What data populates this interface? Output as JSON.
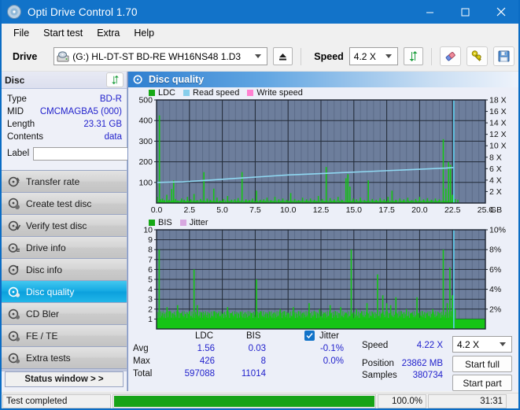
{
  "window": {
    "title": "Opti Drive Control 1.70",
    "icon": "disc-icon",
    "minimize": "minimize-icon",
    "maximize": "maximize-icon",
    "close": "close-icon"
  },
  "menu": [
    {
      "label": "File"
    },
    {
      "label": "Start test"
    },
    {
      "label": "Extra"
    },
    {
      "label": "Help"
    }
  ],
  "toolbar": {
    "drive_label": "Drive",
    "drive_value": "(G:)  HL-DT-ST BD-RE  WH16NS48 1.D3",
    "eject_icon": "eject-icon",
    "speed_label": "Speed",
    "speed_value": "4.2 X",
    "refresh_icon": "refresh-icon",
    "eraser_icon": "eraser-icon",
    "settings_icon": "keys-icon",
    "save_icon": "save-icon"
  },
  "disc": {
    "header": "Disc",
    "refresh_icon": "refresh-icon",
    "rows": [
      {
        "key": "Type",
        "value": "BD-R"
      },
      {
        "key": "MID",
        "value": "CMCMAGBA5 (000)"
      },
      {
        "key": "Length",
        "value": "23.31 GB"
      },
      {
        "key": "Contents",
        "value": "data"
      }
    ],
    "label_key": "Label",
    "label_value": "",
    "label_placeholder": "",
    "label_button_icon": "disc-icon"
  },
  "sidebar": {
    "items": [
      {
        "label": "Transfer rate",
        "icon": "disc-speed-icon",
        "active": false
      },
      {
        "label": "Create test disc",
        "icon": "disc-write-icon",
        "active": false
      },
      {
        "label": "Verify test disc",
        "icon": "disc-verify-icon",
        "active": false
      },
      {
        "label": "Drive info",
        "icon": "drive-info-icon",
        "active": false
      },
      {
        "label": "Disc info",
        "icon": "disc-info-icon",
        "active": false
      },
      {
        "label": "Disc quality",
        "icon": "disc-quality-icon",
        "active": true
      },
      {
        "label": "CD Bler",
        "icon": "disc-bler-icon",
        "active": false
      },
      {
        "label": "FE / TE",
        "icon": "disc-fete-icon",
        "active": false
      },
      {
        "label": "Extra tests",
        "icon": "disc-extra-icon",
        "active": false
      }
    ],
    "status_window_button": "Status window > >"
  },
  "panel": {
    "title": "Disc quality",
    "icon": "disc-quality-icon"
  },
  "chart_data": [
    {
      "id": "ldc-chart",
      "type": "line",
      "title": "",
      "xlabel": "GB",
      "ylabel": "",
      "xlim": [
        0.0,
        25.0
      ],
      "xticks": [
        "0.0",
        "2.5",
        "5.0",
        "7.5",
        "10.0",
        "12.5",
        "15.0",
        "17.5",
        "20.0",
        "22.5",
        "25.0"
      ],
      "x_unit": "GB",
      "ylim": [
        0,
        500
      ],
      "yticks": [
        "100",
        "200",
        "300",
        "400",
        "500"
      ],
      "y2lim": [
        0,
        18
      ],
      "y2ticks": [
        "2 X",
        "4 X",
        "6 X",
        "8 X",
        "10 X",
        "12 X",
        "14 X",
        "16 X",
        "18 X"
      ],
      "grid": true,
      "legend_position": "top-left",
      "series": [
        {
          "name": "LDC",
          "color": "#16c416",
          "type": "impulse"
        },
        {
          "name": "Read speed",
          "color": "#87ceeb",
          "type": "line"
        },
        {
          "name": "Write speed",
          "color": "#ff80d0",
          "type": "line"
        }
      ],
      "ldc_spikes": [
        [
          0.05,
          30
        ],
        [
          0.22,
          425
        ],
        [
          0.3,
          18
        ],
        [
          0.45,
          22
        ],
        [
          0.6,
          14
        ],
        [
          0.78,
          40
        ],
        [
          0.95,
          16
        ],
        [
          1.15,
          68
        ],
        [
          1.3,
          110
        ],
        [
          1.45,
          20
        ],
        [
          1.6,
          12
        ],
        [
          1.9,
          22
        ],
        [
          2.1,
          16
        ],
        [
          2.35,
          30
        ],
        [
          2.6,
          18
        ],
        [
          2.85,
          44
        ],
        [
          3.1,
          14
        ],
        [
          3.35,
          20
        ],
        [
          3.6,
          150
        ],
        [
          3.85,
          22
        ],
        [
          4.1,
          16
        ],
        [
          4.35,
          70
        ],
        [
          4.6,
          26
        ],
        [
          4.85,
          12
        ],
        [
          5.1,
          20
        ],
        [
          5.4,
          34
        ],
        [
          5.7,
          16
        ],
        [
          5.95,
          18
        ],
        [
          6.2,
          24
        ],
        [
          6.5,
          150
        ],
        [
          6.8,
          18
        ],
        [
          7.05,
          14
        ],
        [
          7.3,
          22
        ],
        [
          7.6,
          60
        ],
        [
          7.9,
          16
        ],
        [
          8.15,
          18
        ],
        [
          8.4,
          26
        ],
        [
          8.7,
          14
        ],
        [
          9.0,
          30
        ],
        [
          9.3,
          18
        ],
        [
          9.6,
          22
        ],
        [
          9.9,
          16
        ],
        [
          10.2,
          48
        ],
        [
          10.5,
          20
        ],
        [
          10.8,
          14
        ],
        [
          11.1,
          26
        ],
        [
          11.4,
          18
        ],
        [
          11.7,
          22
        ],
        [
          12.0,
          16
        ],
        [
          12.3,
          34
        ],
        [
          12.6,
          20
        ],
        [
          12.9,
          175
        ],
        [
          13.2,
          24
        ],
        [
          13.5,
          18
        ],
        [
          13.8,
          30
        ],
        [
          14.1,
          16
        ],
        [
          14.4,
          120
        ],
        [
          14.55,
          140
        ],
        [
          14.7,
          80
        ],
        [
          14.95,
          22
        ],
        [
          15.2,
          18
        ],
        [
          15.5,
          26
        ],
        [
          15.8,
          14
        ],
        [
          16.1,
          110
        ],
        [
          16.4,
          20
        ],
        [
          16.7,
          16
        ],
        [
          17.0,
          24
        ],
        [
          17.3,
          18
        ],
        [
          17.6,
          30
        ],
        [
          17.9,
          60
        ],
        [
          18.2,
          16
        ],
        [
          18.5,
          22
        ],
        [
          18.8,
          18
        ],
        [
          19.1,
          26
        ],
        [
          19.4,
          14
        ],
        [
          19.7,
          20
        ],
        [
          20.0,
          30
        ],
        [
          20.3,
          18
        ],
        [
          20.6,
          24
        ],
        [
          20.9,
          16
        ],
        [
          21.2,
          22
        ],
        [
          21.5,
          18
        ],
        [
          21.8,
          310
        ],
        [
          22.0,
          70
        ],
        [
          22.2,
          200
        ],
        [
          22.35,
          185
        ],
        [
          22.5,
          40
        ],
        [
          22.7,
          20
        ],
        [
          22.9,
          16
        ]
      ],
      "read_speed_curve": [
        [
          0.0,
          3.6
        ],
        [
          2.0,
          3.7
        ],
        [
          4.0,
          4.0
        ],
        [
          6.0,
          4.3
        ],
        [
          8.0,
          4.6
        ],
        [
          10.0,
          4.9
        ],
        [
          12.0,
          5.1
        ],
        [
          14.0,
          5.3
        ],
        [
          16.0,
          5.5
        ],
        [
          18.0,
          5.7
        ],
        [
          20.0,
          5.9
        ],
        [
          22.0,
          6.1
        ],
        [
          22.6,
          6.2
        ]
      ],
      "end_marker_x": 22.6
    },
    {
      "id": "bis-chart",
      "type": "line",
      "title": "",
      "xlabel": "GB",
      "ylabel": "",
      "xlim": [
        0.0,
        25.0
      ],
      "xticks": [
        "0.0",
        "2.5",
        "5.0",
        "7.5",
        "10.0",
        "12.5",
        "15.0",
        "17.5",
        "20.0",
        "22.5",
        "25.0"
      ],
      "x_unit": "GB",
      "ylim": [
        0,
        10
      ],
      "yticks": [
        "1",
        "2",
        "3",
        "4",
        "5",
        "6",
        "7",
        "8",
        "9",
        "10"
      ],
      "y2lim": [
        0,
        10
      ],
      "y2ticks": [
        "2%",
        "4%",
        "6%",
        "8%",
        "10%"
      ],
      "grid": true,
      "legend_position": "top-left",
      "series": [
        {
          "name": "BIS",
          "color": "#16c416",
          "type": "impulse"
        },
        {
          "name": "Jitter",
          "color": "#d8a8e0",
          "type": "line"
        }
      ],
      "bis_baseline": 1,
      "bis_spikes": [
        [
          0.2,
          8
        ],
        [
          0.45,
          1.6
        ],
        [
          0.8,
          2.2
        ],
        [
          1.0,
          1.8
        ],
        [
          1.25,
          1.5
        ],
        [
          1.6,
          2.4
        ],
        [
          1.9,
          1.6
        ],
        [
          2.2,
          1.5
        ],
        [
          2.5,
          1.8
        ],
        [
          2.85,
          6
        ],
        [
          3.1,
          2.4
        ],
        [
          3.4,
          1.7
        ],
        [
          3.7,
          1.6
        ],
        [
          4.0,
          1.5
        ],
        [
          4.4,
          1.8
        ],
        [
          4.7,
          1.6
        ],
        [
          5.0,
          1.5
        ],
        [
          5.4,
          2.2
        ],
        [
          5.7,
          1.6
        ],
        [
          6.0,
          1.5
        ],
        [
          6.4,
          1.7
        ],
        [
          6.8,
          1.5
        ],
        [
          7.2,
          1.6
        ],
        [
          7.6,
          5
        ],
        [
          7.9,
          1.8
        ],
        [
          8.3,
          1.5
        ],
        [
          8.6,
          1.7
        ],
        [
          9.0,
          1.6
        ],
        [
          9.4,
          2.0
        ],
        [
          9.7,
          1.8
        ],
        [
          10.0,
          1.6
        ],
        [
          10.4,
          2.2
        ],
        [
          10.8,
          1.8
        ],
        [
          11.2,
          1.6
        ],
        [
          11.6,
          2.6
        ],
        [
          12.0,
          1.8
        ],
        [
          12.4,
          2.0
        ],
        [
          12.8,
          1.6
        ],
        [
          13.2,
          2.4
        ],
        [
          13.6,
          1.8
        ],
        [
          14.0,
          2.2
        ],
        [
          14.4,
          1.6
        ],
        [
          14.8,
          8
        ],
        [
          15.2,
          2.0
        ],
        [
          15.6,
          1.8
        ],
        [
          16.0,
          2.6
        ],
        [
          16.4,
          1.7
        ],
        [
          16.8,
          5.5
        ],
        [
          17.2,
          3.4
        ],
        [
          17.5,
          2.6
        ],
        [
          17.8,
          2.4
        ],
        [
          18.2,
          3.2
        ],
        [
          18.6,
          1.8
        ],
        [
          19.0,
          2.0
        ],
        [
          19.4,
          1.6
        ],
        [
          19.8,
          3.2
        ],
        [
          20.2,
          1.8
        ],
        [
          20.6,
          1.6
        ],
        [
          21.0,
          2.0
        ],
        [
          21.4,
          1.7
        ],
        [
          21.8,
          8
        ],
        [
          22.1,
          2.6
        ],
        [
          22.3,
          6.2
        ],
        [
          22.5,
          3.4
        ],
        [
          22.7,
          2.0
        ]
      ],
      "end_marker_x": 22.6
    }
  ],
  "stats": {
    "columns": [
      "LDC",
      "BIS"
    ],
    "rows": [
      {
        "label": "Avg",
        "ldc": "1.56",
        "bis": "0.03"
      },
      {
        "label": "Max",
        "ldc": "426",
        "bis": "8"
      },
      {
        "label": "Total",
        "ldc": "597088",
        "bis": "11014"
      }
    ],
    "jitter": {
      "checked": true,
      "label": "Jitter",
      "avg": "-0.1%",
      "max": "0.0%"
    },
    "right": {
      "speed_label": "Speed",
      "speed_value": "4.22 X",
      "position_label": "Position",
      "position_value": "23862 MB",
      "samples_label": "Samples",
      "samples_value": "380734",
      "speed_select": "4.2 X",
      "start_full": "Start full",
      "start_part": "Start part"
    }
  },
  "statusbar": {
    "text": "Test completed",
    "progress": 100.0,
    "percent": "100.0%",
    "time": "31:31"
  }
}
